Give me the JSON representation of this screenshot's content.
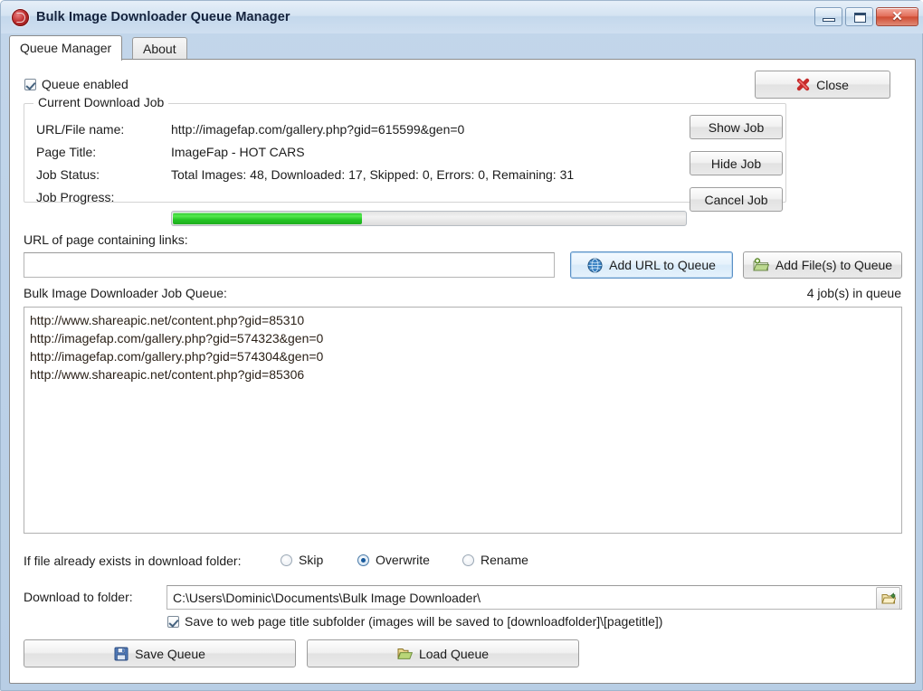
{
  "window": {
    "title": "Bulk Image Downloader Queue Manager",
    "app_icon": "bid-logo-icon",
    "controls": {
      "minimize": "minimize-icon",
      "maximize": "maximize-icon",
      "close": "close-icon",
      "close_glyph": "✕"
    }
  },
  "tabs": [
    {
      "label": "Queue Manager",
      "active": true
    },
    {
      "label": "About",
      "active": false
    }
  ],
  "queue_enabled": {
    "label": "Queue enabled",
    "checked": true
  },
  "close_button": {
    "label": "Close",
    "icon": "red-x-icon"
  },
  "current_job": {
    "legend": "Current Download Job",
    "fields": [
      {
        "label": "URL/File name:",
        "value": "http://imagefap.com/gallery.php?gid=615599&gen=0"
      },
      {
        "label": "Page Title:",
        "value": "ImageFap - HOT CARS"
      },
      {
        "label": "Job Status:",
        "value": "Total Images: 48, Downloaded: 17, Skipped: 0, Errors: 0, Remaining: 31"
      },
      {
        "label": "Job Progress:",
        "value": ""
      }
    ],
    "progress_percent": 37,
    "buttons": [
      {
        "label": "Show Job"
      },
      {
        "label": "Hide Job"
      },
      {
        "label": "Cancel Job"
      }
    ]
  },
  "url_section": {
    "label": "URL of page containing links:",
    "input_value": "",
    "input_placeholder": "",
    "add_url_button": {
      "label": "Add URL to Queue",
      "icon": "globe-icon"
    },
    "add_files_button": {
      "label": "Add File(s) to Queue",
      "icon": "folder-add-icon"
    }
  },
  "queue_section": {
    "label": "Bulk Image Downloader Job Queue:",
    "count_label": "4 job(s) in queue",
    "items": [
      "http://www.shareapic.net/content.php?gid=85310",
      "http://imagefap.com/gallery.php?gid=574323&gen=0",
      "http://imagefap.com/gallery.php?gid=574304&gen=0",
      "http://www.shareapic.net/content.php?gid=85306"
    ]
  },
  "exists_options": {
    "label": "If file already exists in download folder:",
    "options": [
      {
        "label": "Skip",
        "selected": false
      },
      {
        "label": "Overwrite",
        "selected": true
      },
      {
        "label": "Rename",
        "selected": false
      }
    ]
  },
  "download_folder": {
    "label": "Download to folder:",
    "path": "C:\\Users\\Dominic\\Documents\\Bulk Image Downloader\\",
    "browse_icon": "folder-browse-icon"
  },
  "subfolder_option": {
    "label": "Save to web page title subfolder (images will be saved to [downloadfolder]\\[pagetitle])",
    "checked": true
  },
  "bottom_buttons": {
    "save": {
      "label": "Save Queue",
      "icon": "floppy-disk-icon"
    },
    "load": {
      "label": "Load Queue",
      "icon": "open-folder-icon"
    }
  },
  "colors": {
    "progress_green": "#2cc62c",
    "accent_blue": "#17599c",
    "close_red": "#cf4c33"
  }
}
